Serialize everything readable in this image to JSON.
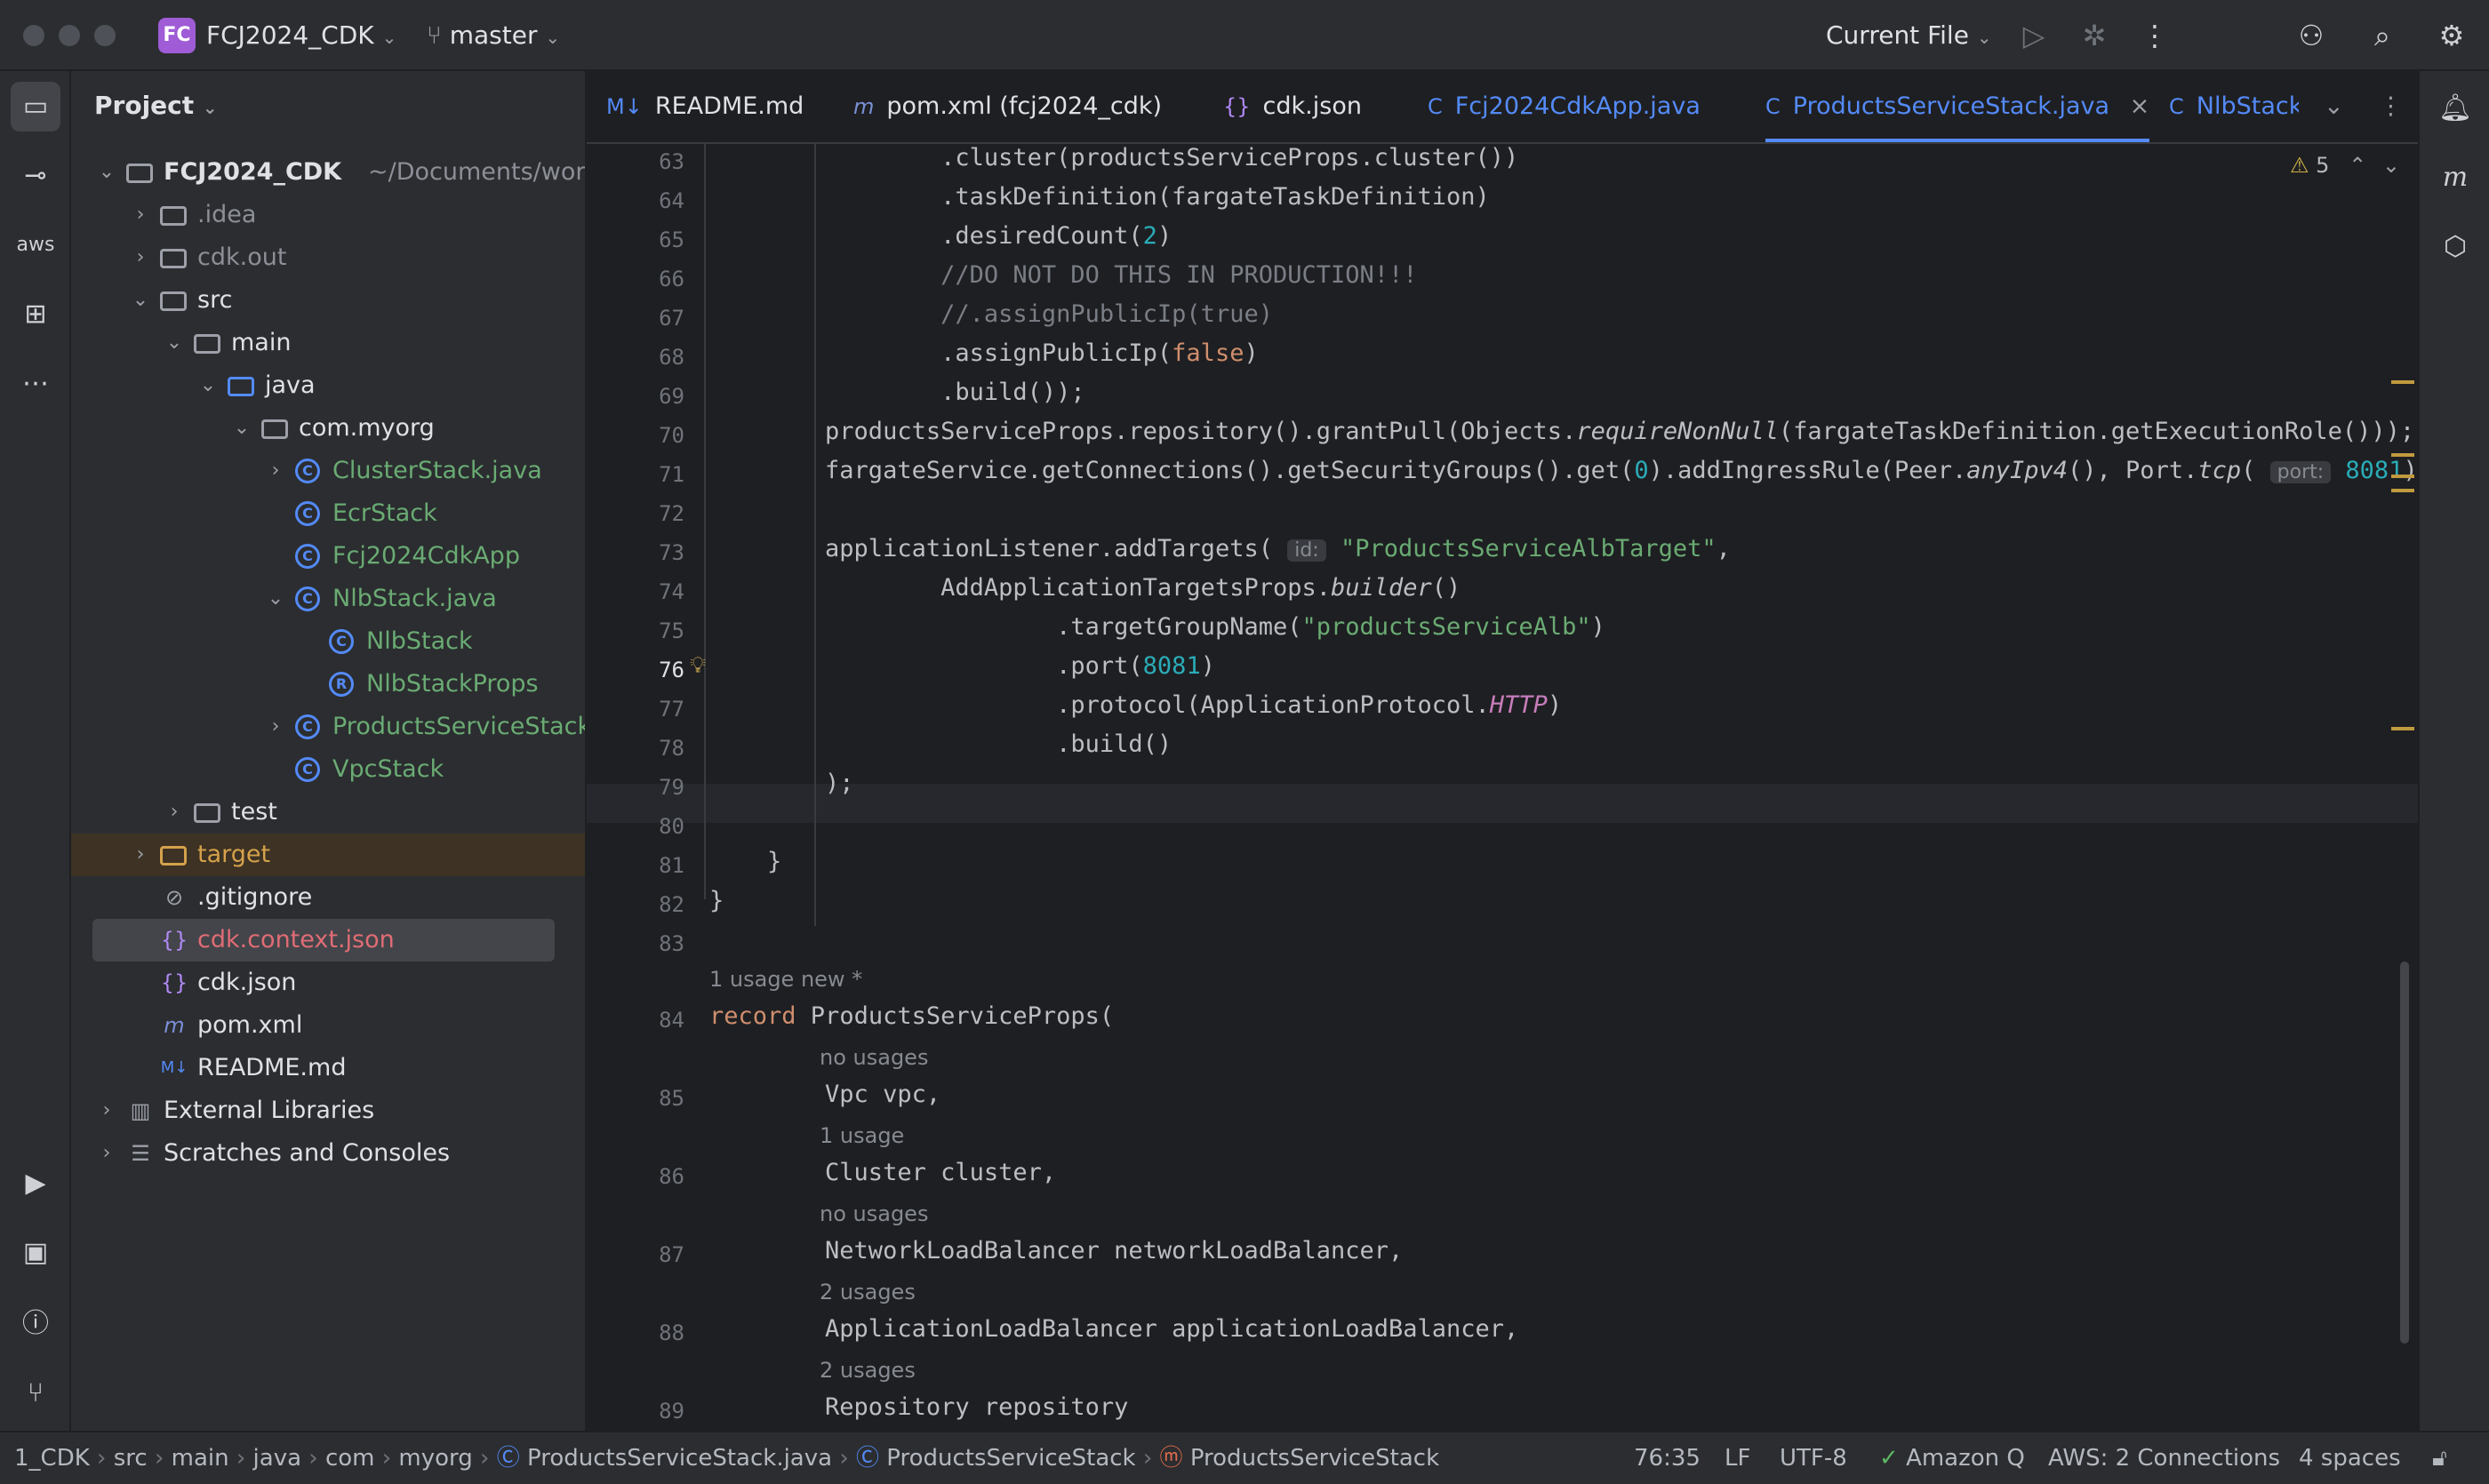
{
  "titlebar": {
    "project_initials": "FC",
    "project_name": "FCJ2024_CDK",
    "branch": "master",
    "run_config": "Current File"
  },
  "project_panel": {
    "title": "Project",
    "tree": [
      {
        "label": "FCJ2024_CDK",
        "suffix": "~/Documents/workshop",
        "kind": "module"
      },
      {
        "label": ".idea",
        "kind": "folder"
      },
      {
        "label": "cdk.out",
        "kind": "folder"
      },
      {
        "label": "src",
        "kind": "folder"
      },
      {
        "label": "main",
        "kind": "folder"
      },
      {
        "label": "java",
        "kind": "folder"
      },
      {
        "label": "com.myorg",
        "kind": "package"
      },
      {
        "label": "ClusterStack.java",
        "kind": "class"
      },
      {
        "label": "EcrStack",
        "kind": "class"
      },
      {
        "label": "Fcj2024CdkApp",
        "kind": "class"
      },
      {
        "label": "NlbStack.java",
        "kind": "class"
      },
      {
        "label": "NlbStack",
        "kind": "class"
      },
      {
        "label": "NlbStackProps",
        "kind": "record"
      },
      {
        "label": "ProductsServiceStack.j",
        "kind": "class"
      },
      {
        "label": "VpcStack",
        "kind": "class"
      },
      {
        "label": "test",
        "kind": "folder"
      },
      {
        "label": "target",
        "kind": "folder"
      },
      {
        "label": ".gitignore",
        "kind": "file"
      },
      {
        "label": "cdk.context.json",
        "kind": "json"
      },
      {
        "label": "cdk.json",
        "kind": "json"
      },
      {
        "label": "pom.xml",
        "kind": "maven"
      },
      {
        "label": "README.md",
        "kind": "markdown"
      },
      {
        "label": "External Libraries",
        "kind": "library"
      },
      {
        "label": "Scratches and Consoles",
        "kind": "scratch"
      }
    ]
  },
  "tabs": [
    {
      "label": "README.md",
      "icon": "M↓"
    },
    {
      "label": "pom.xml (fcj2024_cdk)",
      "icon": "m"
    },
    {
      "label": "cdk.json",
      "icon": "{}"
    },
    {
      "label": "Fcj2024CdkApp.java",
      "icon": "C"
    },
    {
      "label": "ProductsServiceStack.java",
      "icon": "C"
    },
    {
      "label": "NlbStack",
      "icon": "C"
    }
  ],
  "editor": {
    "warning_count": "5",
    "line_numbers": [
      "63",
      "64",
      "65",
      "66",
      "67",
      "68",
      "69",
      "70",
      "71",
      "72",
      "73",
      "74",
      "75",
      "76",
      "77",
      "78",
      "79",
      "80",
      "81",
      "82",
      "83",
      "84",
      "85",
      "86",
      "87",
      "88",
      "89"
    ],
    "hints": [
      "1 usage   new *",
      "no usages",
      "1 usage",
      "no usages",
      "2 usages",
      "2 usages"
    ],
    "inlay_id": "id:",
    "inlay_port": "port:"
  },
  "statusbar": {
    "breadcrumb": [
      "1_CDK",
      "src",
      "main",
      "java",
      "com",
      "myorg",
      "ProductsServiceStack.java",
      "ProductsServiceStack",
      "ProductsServiceStack"
    ],
    "position": "76:35",
    "line_sep": "LF",
    "encoding": "UTF-8",
    "amazon_q": "Amazon Q",
    "aws": "AWS: 2 Connections",
    "indent": "4 spaces"
  },
  "colors": {
    "accent": "#548af7",
    "folder_target": "#d5a14b",
    "modified": "#6aab73"
  }
}
